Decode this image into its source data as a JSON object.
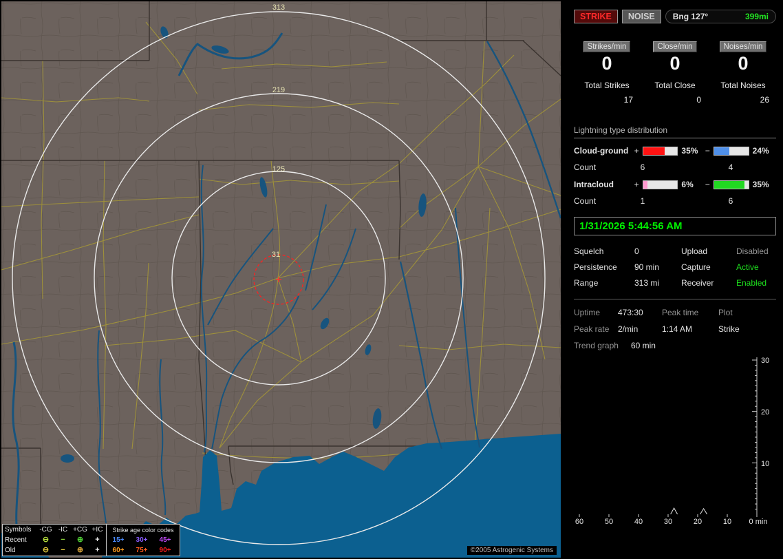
{
  "map": {
    "ring_labels": [
      "313",
      "219",
      "125",
      "31"
    ],
    "copyright": "©2005 Astrogenic Systems",
    "legend": {
      "symbols_header": "Symbols",
      "columns": [
        "-CG",
        "-IC",
        "+CG",
        "+IC"
      ],
      "age_header": "Strike age color codes",
      "rows": [
        {
          "label": "Recent",
          "symbols": [
            {
              "glyph": "⊖",
              "style": "color:#b8e23e"
            },
            {
              "glyph": "−",
              "style": "color:#8ed83a"
            },
            {
              "glyph": "⊕",
              "style": "color:#52d637"
            },
            {
              "glyph": "+",
              "style": "color:#ececec"
            }
          ],
          "ages": [
            {
              "label": "15+",
              "style": "color:#4b8bff"
            },
            {
              "label": "30+",
              "style": "color:#8a5bff"
            },
            {
              "label": "45+",
              "style": "color:#c64bff"
            }
          ]
        },
        {
          "label": "Old",
          "symbols": [
            {
              "glyph": "⊖",
              "style": "color:#ddc63b"
            },
            {
              "glyph": "−",
              "style": "color:#ddc63b"
            },
            {
              "glyph": "⊕",
              "style": "color:#dda83b"
            },
            {
              "glyph": "+",
              "style": "color:#ececec"
            }
          ],
          "ages": [
            {
              "label": "60+",
              "style": "color:#ff9d1e"
            },
            {
              "label": "75+",
              "style": "color:#ff5a1e"
            },
            {
              "label": "90+",
              "style": "color:#ff1e1e"
            }
          ]
        }
      ]
    }
  },
  "panel": {
    "mode_buttons": {
      "strike": "STRIKE",
      "noise": "NOISE"
    },
    "bearing": {
      "label": "Bng 127°",
      "distance": "399mi"
    },
    "counters": [
      {
        "rate_label": "Strikes/min",
        "rate": "0",
        "total_label": "Total Strikes",
        "total": "17"
      },
      {
        "rate_label": "Close/min",
        "rate": "0",
        "total_label": "Total Close",
        "total": "0"
      },
      {
        "rate_label": "Noises/min",
        "rate": "0",
        "total_label": "Total Noises",
        "total": "26"
      }
    ],
    "distribution": {
      "title": "Lightning type distribution",
      "rows": [
        {
          "label": "Cloud-ground",
          "plus_sign": "+",
          "plus_pct": "35%",
          "plus_fill": "width:62%;background:#ff1212",
          "minus_sign": "−",
          "minus_pct": "24%",
          "minus_fill": "width:44%;background:#4f8fe8",
          "count_label": "Count",
          "plus_count": "6",
          "minus_count": "4"
        },
        {
          "label": "Intracloud",
          "plus_sign": "+",
          "plus_pct": "6%",
          "plus_fill": "width:13%;background:#ff9ad0",
          "minus_sign": "−",
          "minus_pct": "35%",
          "minus_fill": "width:88%;background:#22d822",
          "count_label": "Count",
          "plus_count": "1",
          "minus_count": "6"
        }
      ]
    },
    "timestamp": "1/31/2026 5:44:56 AM",
    "status_rows": [
      {
        "label": "Squelch",
        "value": "0",
        "value_style": "color:#e8e8e8",
        "label2": "Upload",
        "value2": "Disabled",
        "value2_style": "color:#949494"
      },
      {
        "label": "Persistence",
        "value": "90 min",
        "value_style": "color:#e8e8e8",
        "label2": "Capture",
        "value2": "Active",
        "value2_style": "color:#1ee01e"
      },
      {
        "label": "Range",
        "value": "313 mi",
        "value_style": "color:#e8e8e8",
        "label2": "Receiver",
        "value2": "Enabled",
        "value2_style": "color:#1ee01e"
      }
    ],
    "stats": {
      "uptime_label": "Uptime",
      "uptime": "473:30",
      "peak_time_label": "Peak time",
      "plot_label": "Plot",
      "peak_rate_label": "Peak rate",
      "peak_rate": "2/min",
      "peak_time": "1:14 AM",
      "plot": "Strike",
      "trend_label": "Trend graph",
      "trend_value": "60 min"
    },
    "trend": {
      "y_ticks": [
        "30",
        "20",
        "10"
      ],
      "x_ticks": [
        "60",
        "50",
        "40",
        "30",
        "20",
        "10"
      ],
      "origin_label": "0 min",
      "spikes": [
        {
          "x": 28,
          "h": 1.2
        },
        {
          "x": 18,
          "h": 1.1
        }
      ]
    }
  }
}
